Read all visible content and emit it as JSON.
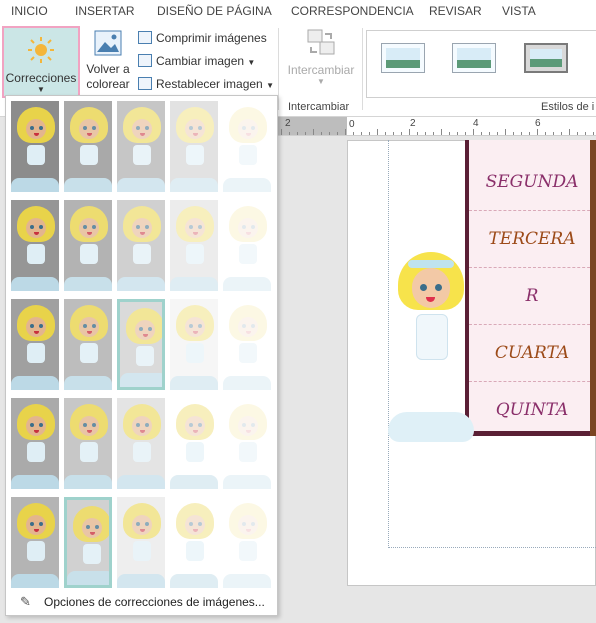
{
  "tabs": [
    "INICIO",
    "INSERTAR",
    "DISEÑO DE PÁGINA",
    "CORRESPONDENCIA",
    "REVISAR",
    "VISTA"
  ],
  "ribbon": {
    "correcciones": "Correcciones",
    "volver_a_colorear_1": "Volver a",
    "volver_a_colorear_2": "colorear",
    "comprimir": "Comprimir imágenes",
    "cambiar": "Cambiar imagen",
    "restablecer": "Restablecer imagen",
    "intercambiar_btn": "Intercambiar",
    "intercambiar_group": "Intercambiar",
    "estilos_group": "Estilos de i"
  },
  "ruler": {
    "labels": [
      "2",
      "",
      "2",
      "4",
      "6"
    ]
  },
  "table_rows": [
    "SEGUNDA",
    "TERCERA",
    "R",
    "CUARTA",
    "QUINTA"
  ],
  "table_colors": [
    "#8a2f6a",
    "#9c4a18",
    "#8a2f6a",
    "#9c4a18",
    "#8a2f6a"
  ],
  "corrections_footer": "Opciones de correcciones de imágenes...",
  "grid": {
    "rows": 5,
    "cols": 5,
    "selected": [
      [
        2,
        2
      ],
      [
        4,
        1
      ]
    ]
  },
  "colors": {
    "accent": "#cbe6e6",
    "highlight_border": "#f1a3c2",
    "table_border": "#5a1f35"
  }
}
